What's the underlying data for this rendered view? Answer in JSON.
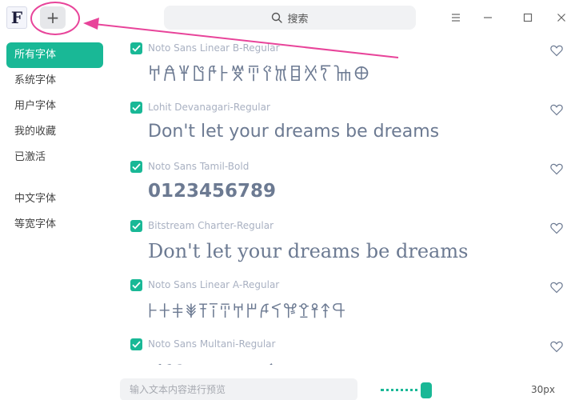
{
  "titlebar": {
    "logo_letter": "F",
    "add_label": "+",
    "search_placeholder": "搜索",
    "search_icon": "search-icon",
    "menu_icon": "hamburger-menu-icon",
    "minimize_icon": "minimize-icon",
    "maximize_icon": "maximize-icon",
    "close_icon": "close-icon"
  },
  "sidebar": {
    "items": [
      {
        "label": "所有字体",
        "active": true
      },
      {
        "label": "系统字体",
        "active": false
      },
      {
        "label": "用户字体",
        "active": false
      },
      {
        "label": "我的收藏",
        "active": false
      },
      {
        "label": "已激活",
        "active": false
      },
      {
        "label": "中文字体",
        "active": false
      },
      {
        "label": "等宽字体",
        "active": false
      }
    ]
  },
  "fonts": [
    {
      "name": "Noto Sans Linear B-Regular",
      "preview": "𐀀𐀁𐀂𐀃𐀄𐀅𐀆𐀇𐀈𐀉𐀊𐀋𐀍𐀎𐀏",
      "checked": true,
      "favorite": false
    },
    {
      "name": "Lohit Devanagari-Regular",
      "preview": "Don't let your dreams be dreams",
      "checked": true,
      "favorite": false
    },
    {
      "name": "Noto Sans Tamil-Bold",
      "preview": "0123456789",
      "checked": true,
      "favorite": false
    },
    {
      "name": "Bitstream Charter-Regular",
      "preview": "Don't let your dreams be dreams",
      "checked": true,
      "favorite": false
    },
    {
      "name": "Noto Sans Linear A-Regular",
      "preview": "𐘀𐘁𐘂𐘃𐘄𐘅𐘆𐘇𐘈𐘉𐘊𐘋𐘌𐘍𐘎𐘏",
      "checked": true,
      "favorite": false
    },
    {
      "name": "Noto Sans Multani-Regular",
      "preview": "𑊀𑊁𑊂𑊃𑊄𑊅𑊆𑊈𑊊𑊋𑊌𑊍",
      "checked": true,
      "favorite": false
    }
  ],
  "bottombar": {
    "preview_placeholder": "输入文本内容进行预览",
    "font_size_label": "30px",
    "font_size_fraction": 0.83
  },
  "colors": {
    "accent": "#19b896",
    "annotation": "#e8449a"
  }
}
